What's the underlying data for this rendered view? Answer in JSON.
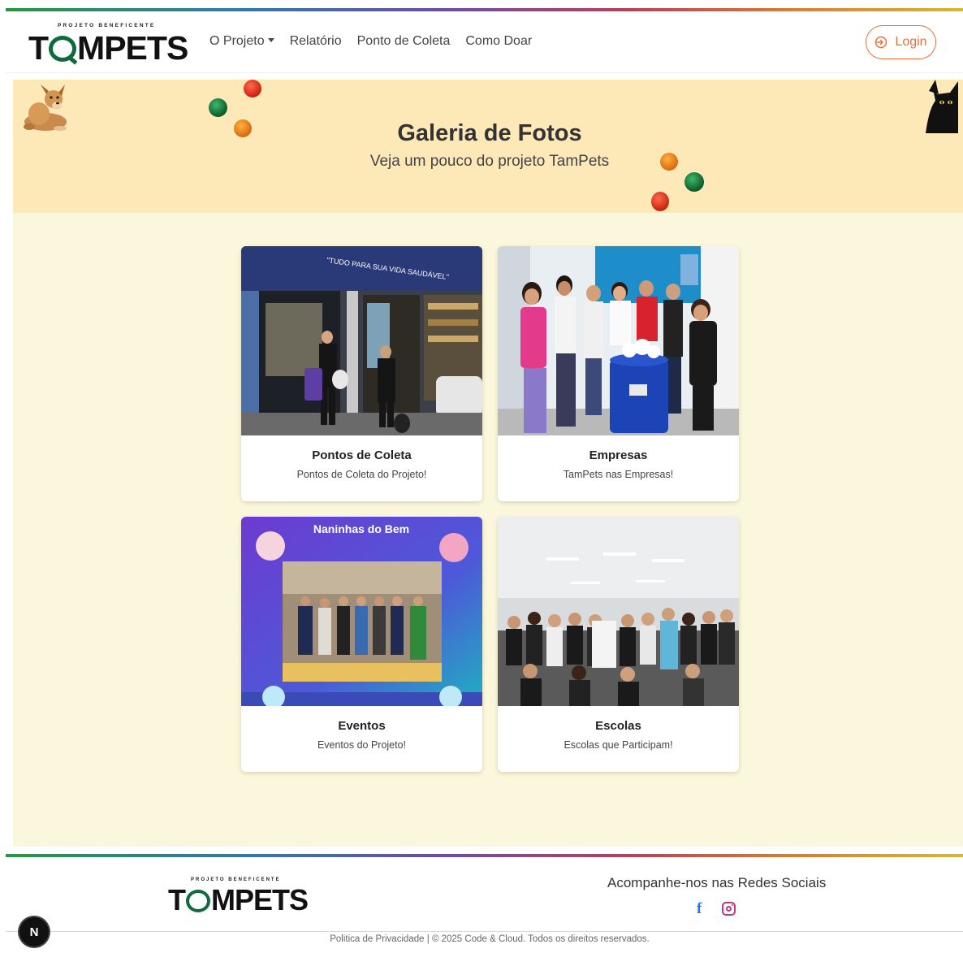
{
  "header": {
    "logo_tag": "PROJETO BENEFICENTE",
    "logo_pre": "T",
    "logo_post": "MPETS",
    "nav": {
      "projeto": "O Projeto",
      "relatorio": "Relatório",
      "ponto": "Ponto de Coleta",
      "doar": "Como Doar"
    },
    "login_label": "Login"
  },
  "banner": {
    "title": "Galeria de Fotos",
    "subtitle": "Veja um pouco do projeto TamPets"
  },
  "gallery": [
    {
      "title": "Pontos de Coleta",
      "description": "Pontos de Coleta do Projeto!"
    },
    {
      "title": "Empresas",
      "description": "TamPets nas Empresas!"
    },
    {
      "title": "Eventos",
      "description": "Eventos do Projeto!"
    },
    {
      "title": "Escolas",
      "description": "Escolas que Participam!"
    }
  ],
  "photo_text": {
    "store_sign": "\"TUDO PARA SUA VIDA SAUDÁVEL\"",
    "event_banner": "Naninhas do Bem"
  },
  "footer": {
    "logo_tag": "PROJETO BENEFICENTE",
    "logo_pre": "T",
    "logo_post": "MPETS",
    "social_title": "Acompanhe-nos nas Redes Sociais",
    "facebook_glyph": "f",
    "copyright": "Politica de Privacidade | © 2025 Code & Cloud. Todos os direitos reservados."
  },
  "dev_badge": "N",
  "colors": {
    "accent": "#e8703a",
    "banner_bg": "#fde8b8",
    "content_bg": "#fbf7dc",
    "logo_green": "#0e6a3b"
  },
  "icons": [
    "chevron-down-icon",
    "login-icon",
    "facebook-icon",
    "instagram-icon"
  ]
}
